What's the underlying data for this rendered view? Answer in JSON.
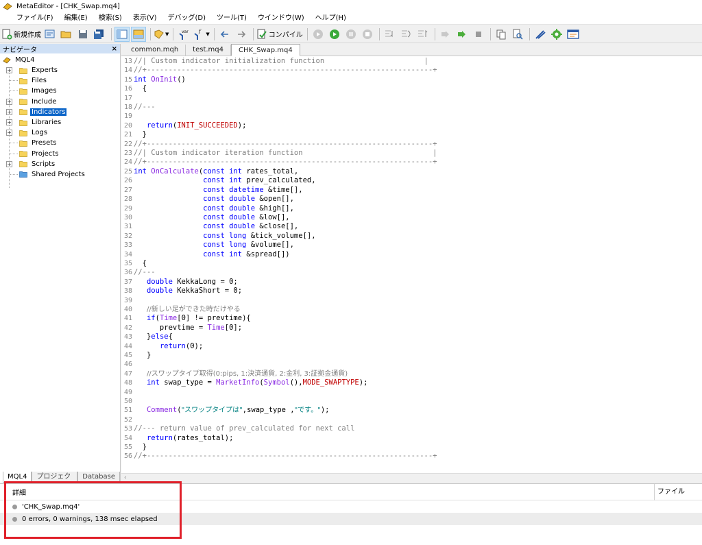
{
  "window": {
    "title": "MetaEditor - [CHK_Swap.mq4]"
  },
  "menu": [
    "ファイル(F)",
    "編集(E)",
    "検索(S)",
    "表示(V)",
    "デバッグ(D)",
    "ツール(T)",
    "ウインドウ(W)",
    "ヘルプ(H)"
  ],
  "toolbar": {
    "new_label": "新規作成",
    "compile_label": "コンパイル"
  },
  "navigator": {
    "title": "ナビゲータ",
    "close": "×",
    "root": "MQL4",
    "items": [
      {
        "label": "Experts",
        "expandable": true
      },
      {
        "label": "Files",
        "expandable": false
      },
      {
        "label": "Images",
        "expandable": false
      },
      {
        "label": "Include",
        "expandable": true
      },
      {
        "label": "Indicators",
        "expandable": true,
        "selected": true
      },
      {
        "label": "Libraries",
        "expandable": true
      },
      {
        "label": "Logs",
        "expandable": true
      },
      {
        "label": "Presets",
        "expandable": false
      },
      {
        "label": "Projects",
        "expandable": false
      },
      {
        "label": "Scripts",
        "expandable": true
      },
      {
        "label": "Shared Projects",
        "expandable": false
      }
    ],
    "tabs": [
      "MQL4",
      "プロジェクト",
      "Database"
    ]
  },
  "editor": {
    "tabs": [
      "common.mqh",
      "test.mq4",
      "CHK_Swap.mq4"
    ],
    "active_tab": 2,
    "lines": [
      {
        "n": "13",
        "t": "//| Custom indicator initialization function                       |"
      },
      {
        "n": "14",
        "t": "//+------------------------------------------------------------------+"
      },
      {
        "n": "15",
        "t": "int OnInit()"
      },
      {
        "n": "16",
        "t": "  {"
      },
      {
        "n": "17",
        "t": ""
      },
      {
        "n": "18",
        "t": "//---"
      },
      {
        "n": "19",
        "t": ""
      },
      {
        "n": "20",
        "t": "   return(INIT_SUCCEEDED);"
      },
      {
        "n": "21",
        "t": "  }"
      },
      {
        "n": "22",
        "t": "//+------------------------------------------------------------------+"
      },
      {
        "n": "23",
        "t": "//| Custom indicator iteration function                              |"
      },
      {
        "n": "24",
        "t": "//+------------------------------------------------------------------+"
      },
      {
        "n": "25",
        "t": "int OnCalculate(const int rates_total,"
      },
      {
        "n": "26",
        "t": "                const int prev_calculated,"
      },
      {
        "n": "27",
        "t": "                const datetime &time[],"
      },
      {
        "n": "28",
        "t": "                const double &open[],"
      },
      {
        "n": "29",
        "t": "                const double &high[],"
      },
      {
        "n": "30",
        "t": "                const double &low[],"
      },
      {
        "n": "31",
        "t": "                const double &close[],"
      },
      {
        "n": "32",
        "t": "                const long &tick_volume[],"
      },
      {
        "n": "33",
        "t": "                const long &volume[],"
      },
      {
        "n": "34",
        "t": "                const int &spread[])"
      },
      {
        "n": "35",
        "t": "  {"
      },
      {
        "n": "36",
        "t": "//---"
      },
      {
        "n": "37",
        "t": "   double KekkaLong = 0;"
      },
      {
        "n": "38",
        "t": "   double KekkaShort = 0;"
      },
      {
        "n": "39",
        "t": ""
      },
      {
        "n": "40",
        "t": "   //新しい足ができた時だけやる"
      },
      {
        "n": "41",
        "t": "   if(Time[0] != prevtime){"
      },
      {
        "n": "42",
        "t": "      prevtime = Time[0];"
      },
      {
        "n": "43",
        "t": "   }else{"
      },
      {
        "n": "44",
        "t": "      return(0);"
      },
      {
        "n": "45",
        "t": "   }"
      },
      {
        "n": "46",
        "t": ""
      },
      {
        "n": "47",
        "t": "   //スワップタイプ取得(0:pips, 1:決済通貨, 2:金利, 3:証拠金通貨)"
      },
      {
        "n": "48",
        "t": "   int swap_type = MarketInfo(Symbol(),MODE_SWAPTYPE);"
      },
      {
        "n": "49",
        "t": ""
      },
      {
        "n": "50",
        "t": ""
      },
      {
        "n": "51",
        "t": "   Comment(\"スワップタイプは\",swap_type ,\"です。\");"
      },
      {
        "n": "52",
        "t": ""
      },
      {
        "n": "53",
        "t": "//--- return value of prev_calculated for next call"
      },
      {
        "n": "54",
        "t": "   return(rates_total);"
      },
      {
        "n": "55",
        "t": "  }"
      },
      {
        "n": "56",
        "t": "//+------------------------------------------------------------------+"
      }
    ],
    "hscroll": "‹"
  },
  "toolbox": {
    "col_detail": "詳細",
    "col_file": "ファイル",
    "messages": [
      "'CHK_Swap.mq4'",
      "0 errors, 0 warnings, 138 msec elapsed"
    ]
  },
  "colors": {
    "highlight": "#e0202a",
    "selection": "#0a64c8"
  }
}
